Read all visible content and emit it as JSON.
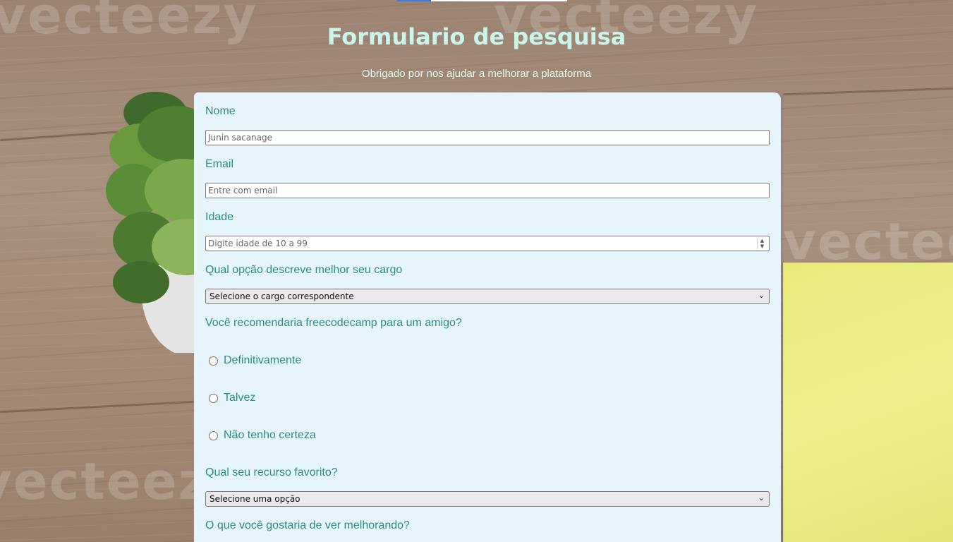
{
  "header": {
    "title": "Formulario de pesquisa",
    "description": "Obrigado por nos ajudar a melhorar a plataforma"
  },
  "background": {
    "watermark": "vecteezy"
  },
  "form": {
    "name": {
      "label": "Nome",
      "placeholder": "Junin sacanage"
    },
    "email": {
      "label": "Email",
      "placeholder": "Entre com email"
    },
    "age": {
      "label": "Idade",
      "placeholder": "Digite idade de 10 a 99"
    },
    "role": {
      "label": "Qual opção descreve melhor seu cargo",
      "selected": "Selecione o cargo correspondente"
    },
    "recommend": {
      "label": "Você recomendaria freecodecamp para um amigo?",
      "options": [
        "Definitivamente",
        "Talvez",
        "Não tenho certeza"
      ]
    },
    "favorite": {
      "label": "Qual seu recurso favorito?",
      "selected": "Selecione uma opção"
    },
    "improve": {
      "label": "O que você gostaria de ver melhorando?"
    }
  },
  "colors": {
    "title": "#c9f5ea",
    "label": "#2b8c86",
    "card": "#e6f5fc"
  }
}
